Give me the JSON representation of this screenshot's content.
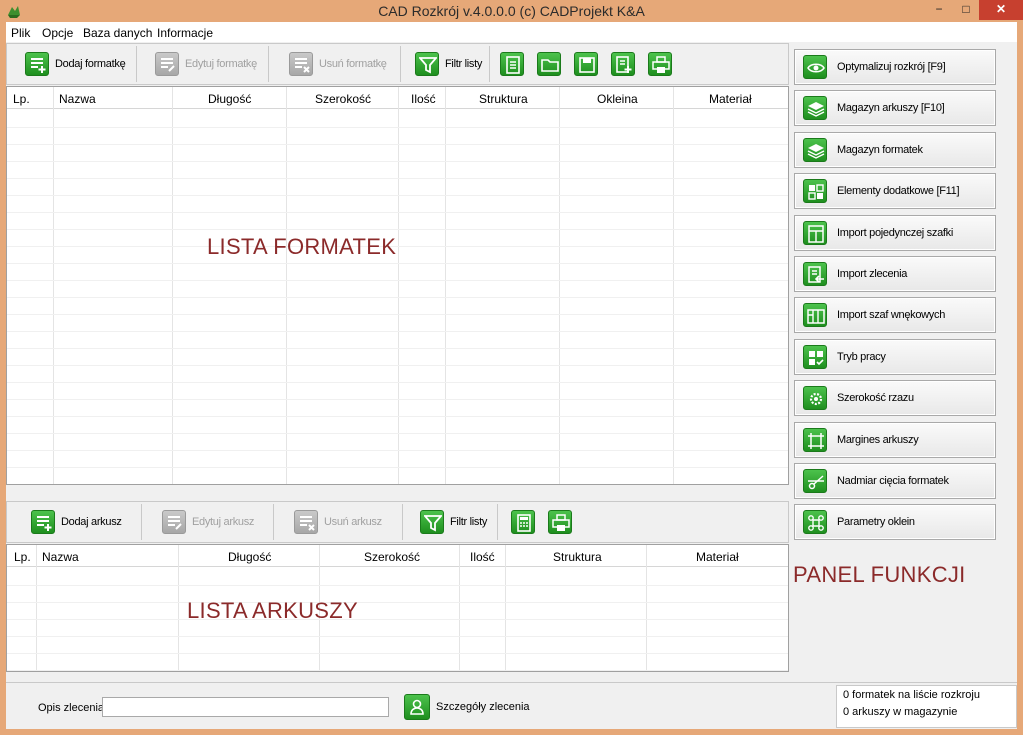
{
  "window": {
    "title": "CAD Rozkrój v.4.0.0.0  (c) CADProjekt K&A",
    "minimize": "−",
    "maximize": "□",
    "close": "✕"
  },
  "menu": [
    "Plik",
    "Opcje",
    "Baza danych",
    "Informacje"
  ],
  "formatki_toolbar": {
    "add": "Dodaj formatkę",
    "edit": "Edytuj formatkę",
    "delete": "Usuń formatkę",
    "filter": "Filtr listy"
  },
  "formatki_table": {
    "columns": [
      "Lp.",
      "Nazwa",
      "Długość",
      "Szerokość",
      "Ilość",
      "Struktura",
      "Okleina",
      "Materiał"
    ],
    "rows": []
  },
  "formatki_overlay": "LISTA FORMATEK",
  "arkusze_toolbar": {
    "add": "Dodaj arkusz",
    "edit": "Edytuj arkusz",
    "delete": "Usuń arkusz",
    "filter": "Filtr listy"
  },
  "arkusze_table": {
    "columns": [
      "Lp.",
      "Nazwa",
      "Długość",
      "Szerokość",
      "Ilość",
      "Struktura",
      "Materiał"
    ],
    "rows": []
  },
  "arkusze_overlay": "LISTA ARKUSZY",
  "panel_overlay": "PANEL FUNKCJI",
  "functions": [
    {
      "label": "Optymalizuj rozkrój [F9]",
      "icon": "eye-icon"
    },
    {
      "label": "Magazyn arkuszy [F10]",
      "icon": "stack-icon"
    },
    {
      "label": "Magazyn formatek",
      "icon": "stack-icon"
    },
    {
      "label": "Elementy dodatkowe [F11]",
      "icon": "blocks-icon"
    },
    {
      "label": "Import pojedynczej szafki",
      "icon": "cabinet-icon"
    },
    {
      "label": "Import zlecenia",
      "icon": "import-doc-icon"
    },
    {
      "label": "Import szaf wnękowych",
      "icon": "wardrobe-icon"
    },
    {
      "label": "Tryb pracy",
      "icon": "mode-icon"
    },
    {
      "label": "Szerokość rzazu",
      "icon": "saw-icon"
    },
    {
      "label": "Margines arkuszy",
      "icon": "margin-icon"
    },
    {
      "label": "Nadmiar cięcia formatek",
      "icon": "cut-icon"
    },
    {
      "label": "Parametry oklein",
      "icon": "command-icon"
    }
  ],
  "status": {
    "opis_label": "Opis zlecenia",
    "opis_value": "",
    "details_button": "Szczegóły zlecenia",
    "formatek_count": "0 formatek na liście rozkroju",
    "arkuszy_count": "0 arkuszy w magazynie"
  },
  "colors": {
    "accent_green": "#2a9d2a",
    "title_bar": "#e6a878",
    "overlay_text": "#8b2a2a"
  }
}
